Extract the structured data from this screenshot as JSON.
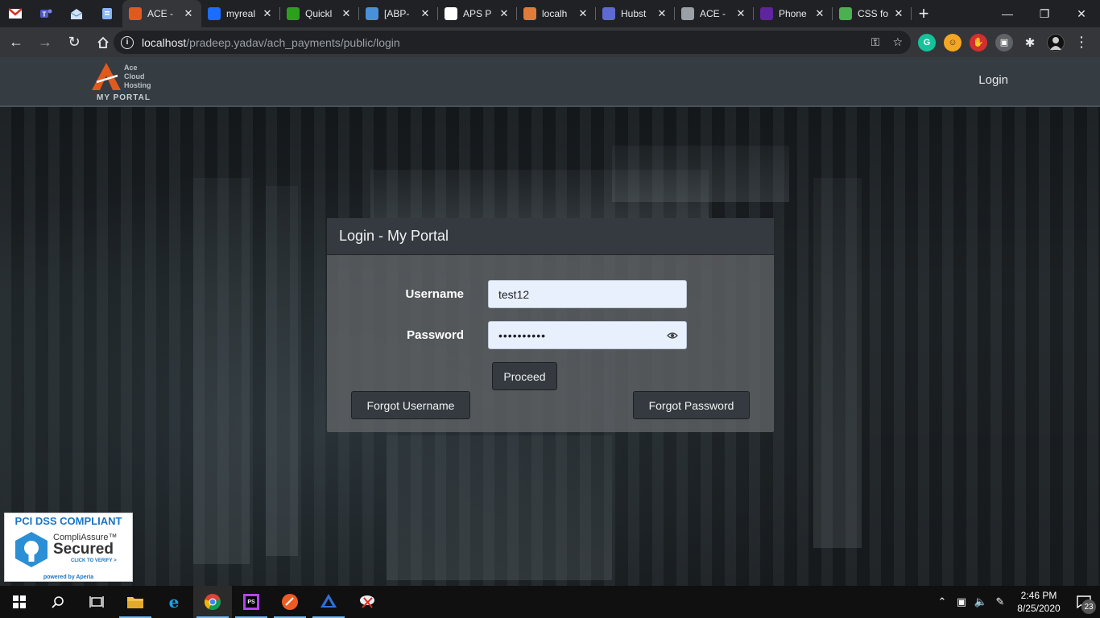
{
  "browser": {
    "tabs": [
      {
        "label": "ACE - ",
        "favicon": "ace-icon",
        "color": "#e05a1e",
        "active": true
      },
      {
        "label": "myreal",
        "favicon": "bitwarden-icon",
        "color": "#1a6dff"
      },
      {
        "label": "Quickl",
        "favicon": "quickbooks-icon",
        "color": "#2ca01c"
      },
      {
        "label": "[ABP-",
        "favicon": "x-icon",
        "color": "#4a90d9"
      },
      {
        "label": "APS P",
        "favicon": "aps-icon",
        "color": "#ffffff"
      },
      {
        "label": "localh",
        "favicon": "localhost-icon",
        "color": "#e07b39"
      },
      {
        "label": "Hubst",
        "favicon": "hubstaff-icon",
        "color": "#5e6ad2"
      },
      {
        "label": "ACE - ",
        "favicon": "chrome-icon",
        "color": "#9aa0a6"
      },
      {
        "label": "Phone",
        "favicon": "phonepe-icon",
        "color": "#5f259f"
      },
      {
        "label": "CSS fo",
        "favicon": "w3schools-icon",
        "color": "#4caf50"
      }
    ],
    "pinned_tabs": [
      "gmail-icon",
      "teams-icon",
      "mail-icon",
      "docs-icon"
    ],
    "url_host": "localhost",
    "url_path": "/pradeep.yadav/ach_payments/public/login"
  },
  "header": {
    "logo_line1": "Ace",
    "logo_line2": "Cloud",
    "logo_line3": "Hosting",
    "logo_portal": "MY PORTAL",
    "nav_login": "Login"
  },
  "login": {
    "title": "Login - My Portal",
    "username_label": "Username",
    "username_value": "test12",
    "password_label": "Password",
    "password_value": "••••••••••",
    "proceed": "Proceed",
    "forgot_username": "Forgot Username",
    "forgot_password": "Forgot Password"
  },
  "badge": {
    "title": "PCI DSS COMPLIANT",
    "name": "CompliAssure™",
    "secured": "Secured",
    "verify": "CLICK TO VERIFY >",
    "powered": "powered by Aperia"
  },
  "taskbar": {
    "time": "2:46 PM",
    "date": "8/25/2020",
    "notifications": "23"
  },
  "colors": {
    "accent": "#343a40",
    "input_bg": "#e8f0fe",
    "brand_orange": "#e05a1e",
    "pci_blue": "#1a74c4"
  }
}
